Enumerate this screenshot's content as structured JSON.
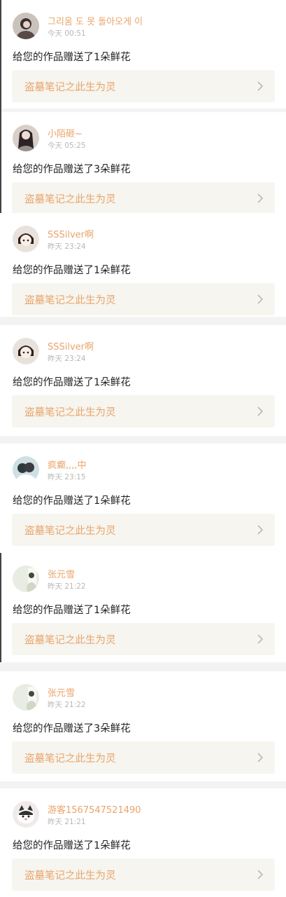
{
  "notifications": [
    {
      "user": "그리움 도 못 돌아오게 이",
      "time": "今天 00:51",
      "message": "给您的作品赠送了1朵鲜花",
      "work": "盗墓笔记之此生为灵",
      "avatar": "portrait-dark-hair-avatar"
    },
    {
      "user": "小陌砸~",
      "time": "今天 05:25",
      "message": "给您的作品赠送了3朵鲜花",
      "work": "盗墓笔记之此生为灵",
      "avatar": "portrait-long-hair-avatar"
    },
    {
      "user": "SSSilver啊",
      "time": "昨天 23:24",
      "message": "给您的作品赠送了1朵鲜花",
      "work": "盗墓笔记之此生为灵",
      "avatar": "cartoon-girl-avatar"
    },
    {
      "user": "SSSilver啊",
      "time": "昨天 23:24",
      "message": "给您的作品赠送了1朵鲜花",
      "work": "盗墓笔记之此生为灵",
      "avatar": "cartoon-girl-avatar"
    },
    {
      "user": "疯癫,,,,中",
      "time": "昨天 23:15",
      "message": "给您的作品赠送了1朵鲜花",
      "work": "盗墓笔记之此生为灵",
      "avatar": "anime-couple-avatar"
    },
    {
      "user": "张元雪",
      "time": "昨天 21:22",
      "message": "给您的作品赠送了1朵鲜花",
      "work": "盗墓笔记之此生为灵",
      "avatar": "light-portrait-avatar"
    },
    {
      "user": "张元雪",
      "time": "昨天 21:22",
      "message": "给您的作品赠送了3朵鲜花",
      "work": "盗墓笔记之此生为灵",
      "avatar": "light-portrait-avatar"
    },
    {
      "user": "游客1567547521490",
      "time": "昨天 21:21",
      "message": "给您的作品赠送了1朵鲜花",
      "work": "盗墓笔记之此生为灵",
      "avatar": "cat-avatar"
    }
  ],
  "colors": {
    "accent": "#e9a46b",
    "time": "#b7b7b7",
    "text": "#222222",
    "work_bg": "#f6f5ef",
    "separator": "#f3f3f3"
  }
}
